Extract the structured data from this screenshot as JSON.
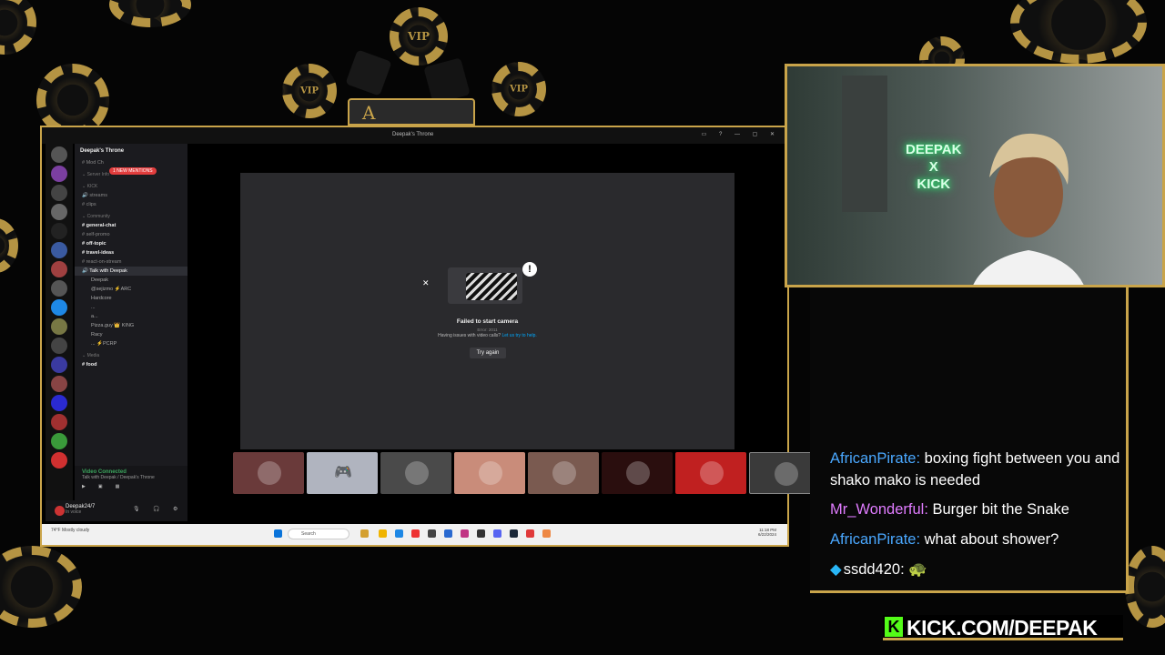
{
  "discord": {
    "window_title": "Deepak's Throne",
    "server_name": "Deepak's Throne",
    "mentions_badge": "1 NEW MENTIONS",
    "channels": [
      {
        "label": "Mod Ch",
        "kind": "text"
      },
      {
        "label": "Server Info",
        "kind": "cat"
      },
      {
        "label": "KICK",
        "kind": "cat"
      },
      {
        "label": "streams",
        "kind": "voice"
      },
      {
        "label": "clips",
        "kind": "text"
      },
      {
        "label": "Community",
        "kind": "cat"
      },
      {
        "label": "general-chat",
        "kind": "bold"
      },
      {
        "label": "self-promo",
        "kind": "text"
      },
      {
        "label": "off-topic",
        "kind": "bold"
      },
      {
        "label": "travel-ideas",
        "kind": "bold"
      },
      {
        "label": "react-on-stream",
        "kind": "text"
      },
      {
        "label": "Talk with Deepak",
        "kind": "sel"
      },
      {
        "label": "Deepak",
        "kind": "u"
      },
      {
        "label": "@sejizmo ⚡ARC",
        "kind": "u"
      },
      {
        "label": "Hardcore",
        "kind": "u"
      },
      {
        "label": "...",
        "kind": "u"
      },
      {
        "label": "a...",
        "kind": "u"
      },
      {
        "label": "Pizza.guy 👑 KING",
        "kind": "u"
      },
      {
        "label": "Racy",
        "kind": "u"
      },
      {
        "label": "... ⚡PCRP",
        "kind": "u"
      },
      {
        "label": "Media",
        "kind": "cat"
      },
      {
        "label": "food",
        "kind": "bold"
      }
    ],
    "voice_status": "Video Connected",
    "voice_sub": "Talk with Deepak / Deepak's Throne",
    "user_name": "Deepak24/7",
    "user_status": "In voice",
    "camera_error": {
      "title": "Failed to start camera",
      "error_code": "Error: 2011",
      "help_text": "Having issues with video calls?",
      "help_link": "Let us try to help.",
      "retry_label": "Try again"
    },
    "thumbnail_colors": [
      "#6a3a3a",
      "#b0b4bf",
      "#4a4a4a",
      "#c98c7a",
      "#7a5a50",
      "#2a0e0e",
      "#c02020",
      "#3a3a3a"
    ],
    "taskbar": {
      "search_placeholder": "Search",
      "weather": "74°F Mostly cloudy",
      "time": "11:18 PM",
      "date": "6/22/2024"
    }
  },
  "webcam": {
    "neon_sign": [
      "DEEPAK",
      "X",
      "KICK"
    ]
  },
  "chat": [
    {
      "user": "AfricanPirate:",
      "user_color": "#4aa8ff",
      "text": "boxing fight between you and shako mako is needed"
    },
    {
      "user": "Mr_Wonderful:",
      "user_color": "#e07cff",
      "text": "Burger bit the Snake"
    },
    {
      "user": "AfricanPirate:",
      "user_color": "#4aa8ff",
      "text": "what about shower?"
    },
    {
      "user": "ssdd420:",
      "user_color": "#ffffff",
      "text": "🐢",
      "icon": "cube-icon"
    }
  ],
  "brand": {
    "logo_letter": "K",
    "url": "KICK.COM/DEEPAK",
    "accent": "#53fc18"
  },
  "overlay": {
    "gold": "#c9a44a",
    "chip_text": "VIP",
    "card_letter": "A"
  }
}
